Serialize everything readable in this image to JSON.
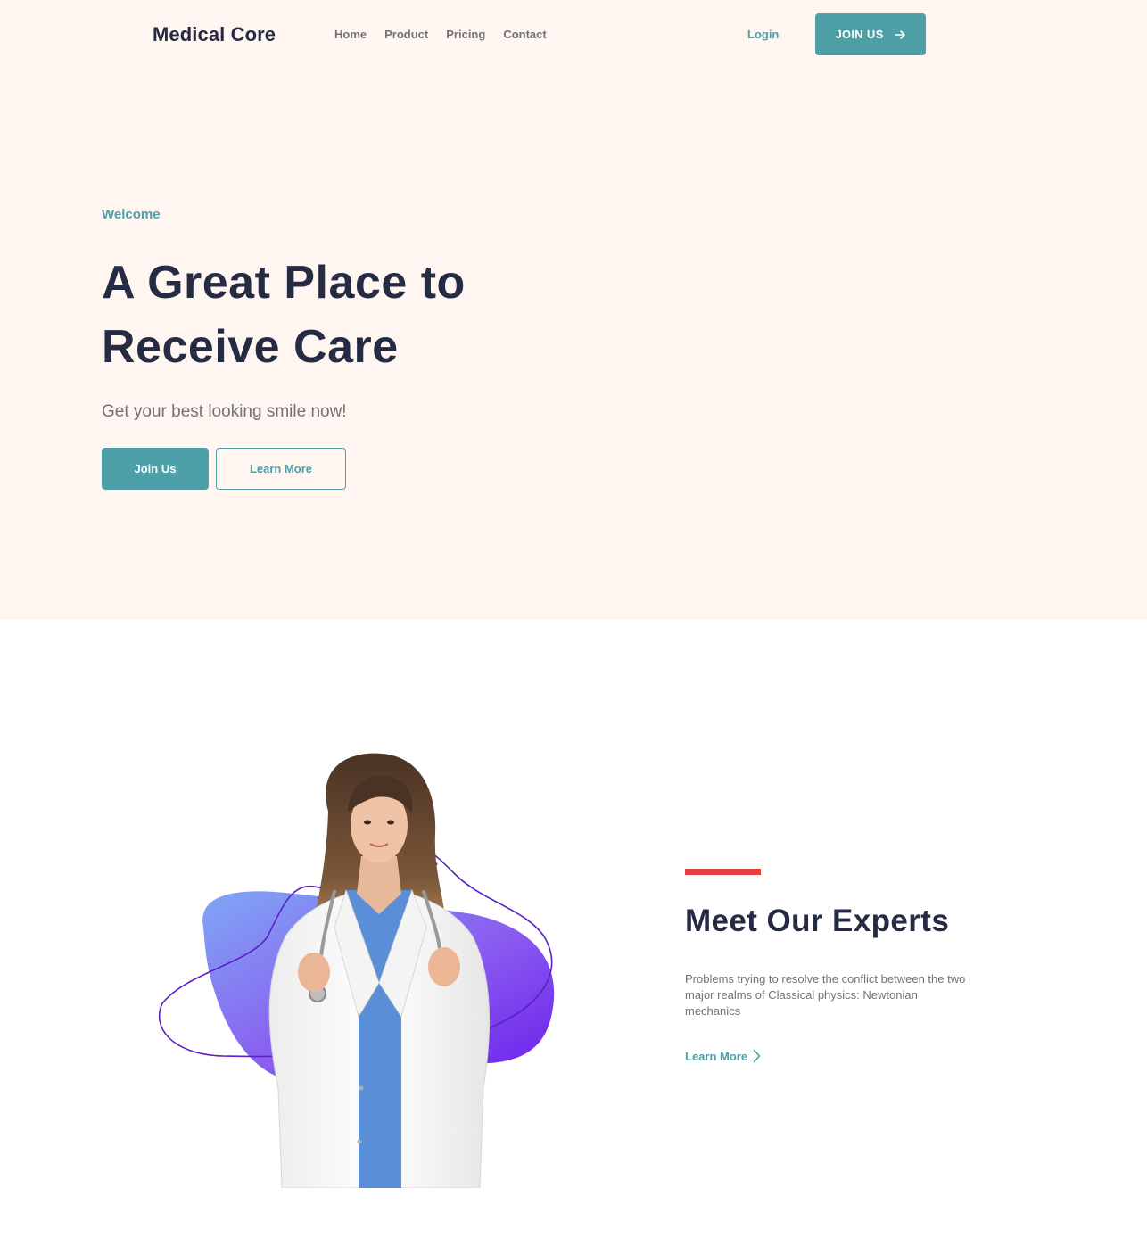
{
  "brand": {
    "name": "Medical Core",
    "accent": "#4D9FA8",
    "dark": "#252B42",
    "muted": "#737373",
    "hero_bg": "#FFF5F1",
    "red": "#E74040"
  },
  "nav": {
    "links": [
      "Home",
      "Product",
      "Pricing",
      "Contact"
    ],
    "login": "Login",
    "cta": "JOIN US",
    "cta_icon": "arrow-right-icon"
  },
  "hero": {
    "eyebrow": "Welcome",
    "title_line1": "A Great Place to",
    "title_line2": "Receive Care",
    "subtitle": "Get your best looking smile now!",
    "primary_button": "Join Us",
    "secondary_button": "Learn More"
  },
  "experts": {
    "title": "Meet Our Experts",
    "text": "Problems trying to resolve the conflict between the two major realms of Classical physics: Newtonian mechanics",
    "link": "Learn More",
    "link_icon": "chevron-right-icon",
    "image_subject": "doctor-with-stethoscope"
  }
}
